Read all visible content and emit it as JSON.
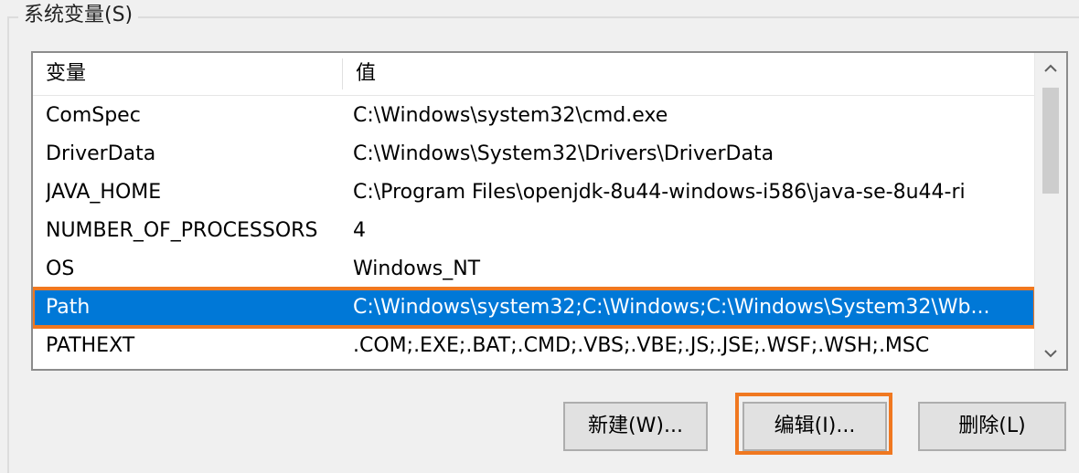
{
  "group": {
    "title": "系统变量(S)"
  },
  "list": {
    "columns": {
      "variable": "变量",
      "value": "值"
    },
    "rows": [
      {
        "name": "ComSpec",
        "value": "C:\\Windows\\system32\\cmd.exe"
      },
      {
        "name": "DriverData",
        "value": "C:\\Windows\\System32\\Drivers\\DriverData"
      },
      {
        "name": "JAVA_HOME",
        "value": "C:\\Program Files\\openjdk-8u44-windows-i586\\java-se-8u44-ri"
      },
      {
        "name": "NUMBER_OF_PROCESSORS",
        "value": "4"
      },
      {
        "name": "OS",
        "value": "Windows_NT"
      },
      {
        "name": "Path",
        "value": "C:\\Windows\\system32;C:\\Windows;C:\\Windows\\System32\\Wb..."
      },
      {
        "name": "PATHEXT",
        "value": ".COM;.EXE;.BAT;.CMD;.VBS;.VBE;.JS;.JSE;.WSF;.WSH;.MSC"
      }
    ],
    "selected_index": 5
  },
  "buttons": {
    "new_label": "新建(W)...",
    "edit_label": "编辑(I)...",
    "delete_label": "删除(L)"
  },
  "colors": {
    "selection": "#0078d7",
    "highlight_box": "#f07820"
  }
}
